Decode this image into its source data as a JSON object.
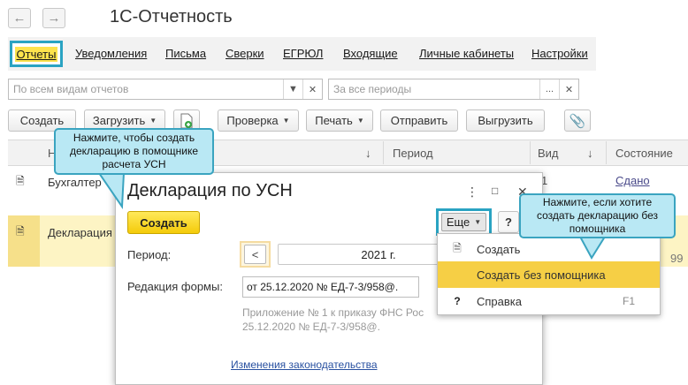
{
  "nav": {
    "back_icon": "arrow-left-icon",
    "forward_icon": "arrow-right-icon"
  },
  "app_title": "1С-Отчетность",
  "tabs": [
    {
      "label": "Отчеты",
      "active": true
    },
    {
      "label": "Уведомления"
    },
    {
      "label": "Письма"
    },
    {
      "label": "Сверки"
    },
    {
      "label": "ЕГРЮЛ"
    },
    {
      "label": "Входящие"
    },
    {
      "label": "Личные кабинеты"
    },
    {
      "label": "Настройки"
    }
  ],
  "filters": {
    "reports_placeholder": "По всем видам отчетов",
    "periods_placeholder": "За все периоды"
  },
  "toolbar": {
    "create": "Создать",
    "load": "Загрузить",
    "check": "Проверка",
    "print": "Печать",
    "send": "Отправить",
    "export": "Выгрузить"
  },
  "table": {
    "headers": {
      "name": "Н",
      "sort_icon": "↓",
      "period": "Период",
      "kind": "Вид",
      "kind_sort": "↓",
      "state": "Состояние"
    },
    "rows": [
      {
        "name": "Бухгалтер",
        "kind": "1",
        "state": "Сдано"
      },
      {
        "name": "Декларация",
        "state": "99"
      }
    ]
  },
  "dialog": {
    "title": "Декларация по УСН",
    "create_button": "Создать",
    "more_button": "Еще",
    "help_button": "?",
    "period_label": "Период:",
    "period_prev": "<",
    "period_value": "2021 г.",
    "edition_label": "Редакция формы:",
    "edition_value": "от 25.12.2020 № ЕД-7-3/958@.",
    "note_line1": "Приложение № 1 к приказу ФНС Рос",
    "note_line2": "25.12.2020 № ЕД-7-3/958@.",
    "law_link": "Изменения законодательства"
  },
  "menu": {
    "items": [
      {
        "label": "Создать",
        "icon": "document-icon"
      },
      {
        "label": "Создать без помощника",
        "highlighted": true
      },
      {
        "label": "Справка",
        "icon": "question-icon",
        "shortcut": "F1"
      }
    ]
  },
  "callouts": {
    "left": "Нажмите, чтобы создать декларацию в помощнике расчета УСН",
    "right": "Нажмите, если хотите создать декларацию без помощника"
  },
  "colors": {
    "accent_blue": "#2aa3c2",
    "callout_bg": "#b9e8f4",
    "highlight_yellow": "#f6cf45",
    "create_yellow": "#f4cb0a"
  }
}
